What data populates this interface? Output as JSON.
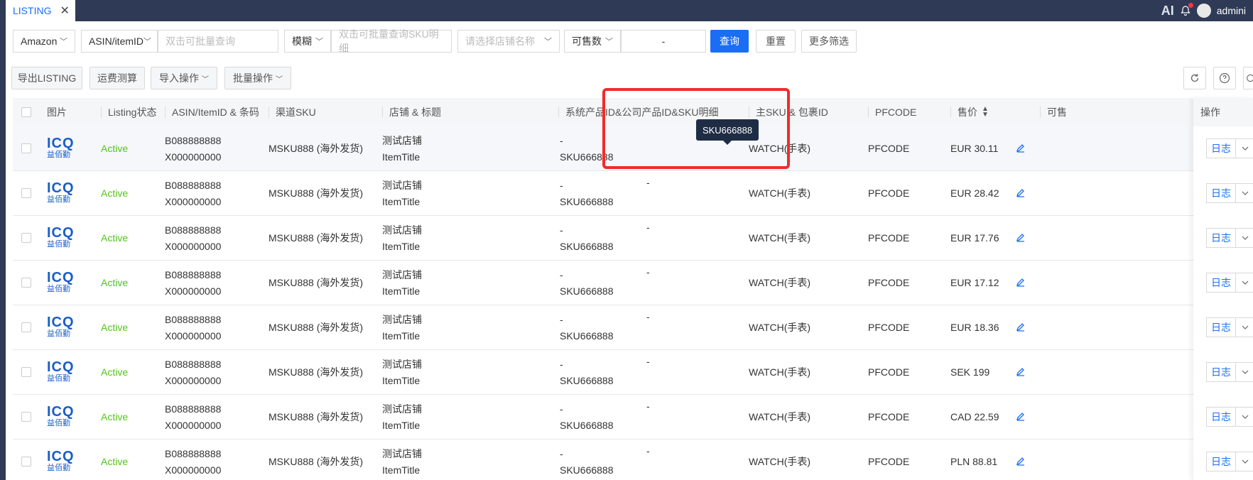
{
  "tab": {
    "label": "LISTING",
    "close": "✕"
  },
  "topbar": {
    "ai": "AI",
    "user": "admini"
  },
  "filters": {
    "platform": "Amazon",
    "id_type": "ASIN/itemID",
    "id_placeholder": "双击可批量查询",
    "match_mode": "模糊",
    "sku_placeholder": "双击可批量查询SKU明细",
    "store_placeholder": "请选择店铺名称",
    "stock_field": "可售数",
    "range_sep": "-",
    "search": "查询",
    "reset": "重置",
    "more": "更多筛选"
  },
  "actions": {
    "export": "导出LISTING",
    "freight": "运费测算",
    "import": "导入操作",
    "batch": "批量操作"
  },
  "columns": {
    "image": "图片",
    "status": "Listing状态",
    "asin": "ASIN/ItemID & 条码",
    "channel_sku": "渠道SKU",
    "store_title": "店铺 & 标题",
    "product_ids": "系统产品ID&公司产品ID&SKU明细",
    "main_sku": "主SKU & 包裹ID",
    "pfcode": "PFCODE",
    "price": "售价",
    "sellable": "可售",
    "ops": "操作"
  },
  "logo": {
    "top": "ICQ",
    "bottom": "益佰勤"
  },
  "rows": [
    {
      "status": "Active",
      "asin": "B088888888",
      "barcode": "X000000000",
      "channel_sku": "MSKU888 (海外发货)",
      "store": "测试店铺",
      "title": "ItemTitle",
      "pid": "-",
      "sku": "SKU666888",
      "cid": "",
      "main_sku": "WATCH(手表)",
      "pfcode": "PFCODE",
      "price": "EUR 30.11",
      "log": "日志"
    },
    {
      "status": "Active",
      "asin": "B088888888",
      "barcode": "X000000000",
      "channel_sku": "MSKU888 (海外发货)",
      "store": "测试店铺",
      "title": "ItemTitle",
      "pid": "-",
      "sku": "SKU666888",
      "cid": "-",
      "main_sku": "WATCH(手表)",
      "pfcode": "PFCODE",
      "price": "EUR 28.42",
      "log": "日志"
    },
    {
      "status": "Active",
      "asin": "B088888888",
      "barcode": "X000000000",
      "channel_sku": "MSKU888 (海外发货)",
      "store": "测试店铺",
      "title": "ItemTitle",
      "pid": "-",
      "sku": "SKU666888",
      "cid": "-",
      "main_sku": "WATCH(手表)",
      "pfcode": "PFCODE",
      "price": "EUR 17.76",
      "log": "日志"
    },
    {
      "status": "Active",
      "asin": "B088888888",
      "barcode": "X000000000",
      "channel_sku": "MSKU888 (海外发货)",
      "store": "测试店铺",
      "title": "ItemTitle",
      "pid": "-",
      "sku": "SKU666888",
      "cid": "-",
      "main_sku": "WATCH(手表)",
      "pfcode": "PFCODE",
      "price": "EUR 17.12",
      "log": "日志"
    },
    {
      "status": "Active",
      "asin": "B088888888",
      "barcode": "X000000000",
      "channel_sku": "MSKU888 (海外发货)",
      "store": "测试店铺",
      "title": "ItemTitle",
      "pid": "-",
      "sku": "SKU666888",
      "cid": "-",
      "main_sku": "WATCH(手表)",
      "pfcode": "PFCODE",
      "price": "EUR 18.36",
      "log": "日志"
    },
    {
      "status": "Active",
      "asin": "B088888888",
      "barcode": "X000000000",
      "channel_sku": "MSKU888 (海外发货)",
      "store": "测试店铺",
      "title": "ItemTitle",
      "pid": "-",
      "sku": "SKU666888",
      "cid": "-",
      "main_sku": "WATCH(手表)",
      "pfcode": "PFCODE",
      "price": "SEK 199",
      "log": "日志"
    },
    {
      "status": "Active",
      "asin": "B088888888",
      "barcode": "X000000000",
      "channel_sku": "MSKU888 (海外发货)",
      "store": "测试店铺",
      "title": "ItemTitle",
      "pid": "-",
      "sku": "SKU666888",
      "cid": "-",
      "main_sku": "WATCH(手表)",
      "pfcode": "PFCODE",
      "price": "CAD 22.59",
      "log": "日志"
    },
    {
      "status": "Active",
      "asin": "B088888888",
      "barcode": "X000000000",
      "channel_sku": "MSKU888 (海外发货)",
      "store": "测试店铺",
      "title": "ItemTitle",
      "pid": "-",
      "sku": "SKU666888",
      "cid": "-",
      "main_sku": "WATCH(手表)",
      "pfcode": "PFCODE",
      "price": "PLN 88.81",
      "log": "日志"
    }
  ],
  "tooltip": "SKU666888",
  "colors": {
    "accent": "#1a6ef5",
    "active": "#52c41a",
    "highlight": "#f52a2a",
    "topbar": "#2f3a56"
  }
}
